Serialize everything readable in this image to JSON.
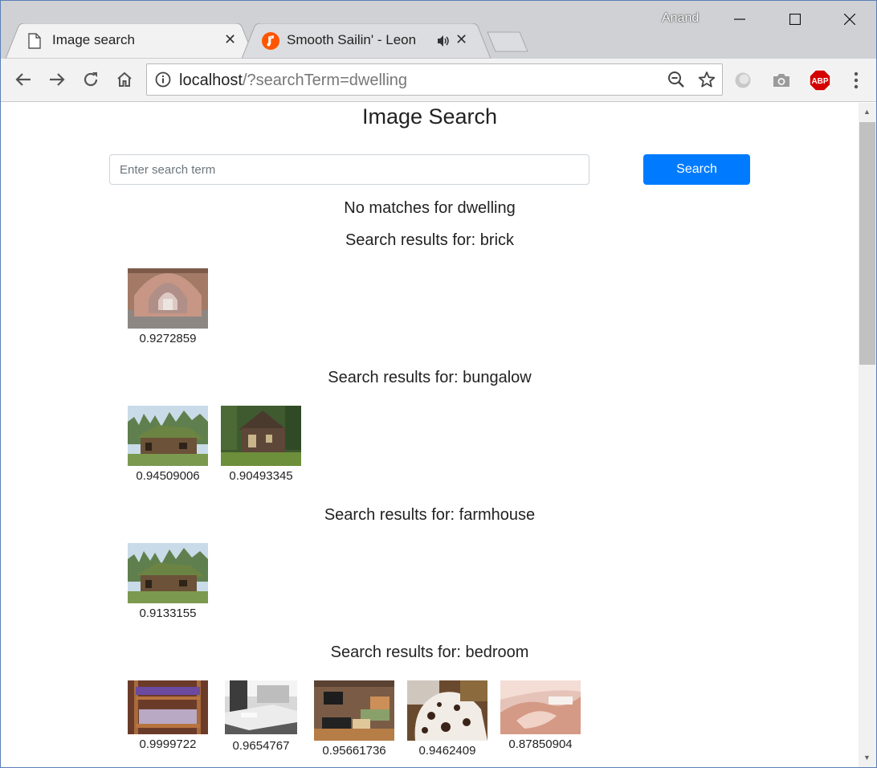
{
  "browser": {
    "profile_name": "Anand",
    "tabs": [
      {
        "title": "Image search",
        "icon": "page-icon"
      },
      {
        "title": "Smooth Sailin' - Leon",
        "icon": "music-icon"
      }
    ],
    "url_host": "localhost",
    "url_path": "/?searchTerm=dwelling",
    "extensions": [
      "ghost-icon",
      "camera-icon",
      "adblock-plus-icon"
    ],
    "adblock_label": "ABP"
  },
  "page": {
    "title": "Image Search",
    "search": {
      "placeholder": "Enter search term",
      "value": "",
      "button_label": "Search"
    },
    "no_matches": "No matches for dwelling",
    "groups": [
      {
        "heading": "Search results for: brick",
        "results": [
          {
            "score": "0.9272859",
            "image": "brick tunnel arches"
          }
        ]
      },
      {
        "heading": "Search results for: bungalow",
        "results": [
          {
            "score": "0.94509006",
            "image": "log cabin with sod roof"
          },
          {
            "score": "0.90493345",
            "image": "wooden cabin in forest"
          }
        ]
      },
      {
        "heading": "Search results for: farmhouse",
        "results": [
          {
            "score": "0.9133155",
            "image": "log cabin with sod roof"
          }
        ]
      },
      {
        "heading": "Search results for: bedroom",
        "results": [
          {
            "score": "0.9999722",
            "image": "bunk bed"
          },
          {
            "score": "0.9654767",
            "image": "black and white bed"
          },
          {
            "score": "0.95661736",
            "image": "living room with tv"
          },
          {
            "score": "0.9462409",
            "image": "dalmatian on bed"
          },
          {
            "score": "0.87850904",
            "image": "hands close-up"
          }
        ]
      }
    ]
  },
  "colors": {
    "primary_button": "#007bff",
    "abp_red": "#d40000",
    "music_orange": "#ff5500"
  }
}
